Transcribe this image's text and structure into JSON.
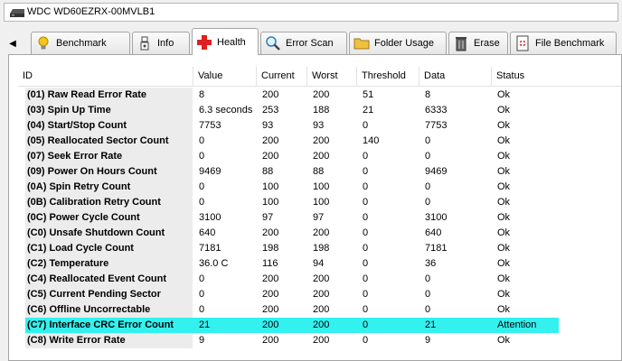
{
  "drive": {
    "label": "WDC WD60EZRX-00MVLB1"
  },
  "tabs": [
    {
      "label": "Benchmark",
      "icon": "light-bulb-icon"
    },
    {
      "label": "Info",
      "icon": "info-icon"
    },
    {
      "label": "Health",
      "icon": "red-cross-icon",
      "active": true
    },
    {
      "label": "Error Scan",
      "icon": "magnifier-icon"
    },
    {
      "label": "Folder Usage",
      "icon": "folder-icon"
    },
    {
      "label": "Erase",
      "icon": "trash-can-icon"
    },
    {
      "label": "File Benchmark",
      "icon": "file-benchmark-icon"
    }
  ],
  "table": {
    "columns": [
      "ID",
      "Value",
      "Current",
      "Worst",
      "Threshold",
      "Data",
      "Status"
    ],
    "rows": [
      [
        "(01) Raw Read Error Rate",
        "8",
        "200",
        "200",
        "51",
        "8",
        "Ok"
      ],
      [
        "(03) Spin Up Time",
        "6.3 seconds",
        "253",
        "188",
        "21",
        "6333",
        "Ok"
      ],
      [
        "(04) Start/Stop Count",
        "7753",
        "93",
        "93",
        "0",
        "7753",
        "Ok"
      ],
      [
        "(05) Reallocated Sector Count",
        "0",
        "200",
        "200",
        "140",
        "0",
        "Ok"
      ],
      [
        "(07) Seek Error Rate",
        "0",
        "200",
        "200",
        "0",
        "0",
        "Ok"
      ],
      [
        "(09) Power On Hours Count",
        "9469",
        "88",
        "88",
        "0",
        "9469",
        "Ok"
      ],
      [
        "(0A) Spin Retry Count",
        "0",
        "100",
        "100",
        "0",
        "0",
        "Ok"
      ],
      [
        "(0B) Calibration Retry Count",
        "0",
        "100",
        "100",
        "0",
        "0",
        "Ok"
      ],
      [
        "(0C) Power Cycle Count",
        "3100",
        "97",
        "97",
        "0",
        "3100",
        "Ok"
      ],
      [
        "(C0) Unsafe Shutdown Count",
        "640",
        "200",
        "200",
        "0",
        "640",
        "Ok"
      ],
      [
        "(C1) Load Cycle Count",
        "7181",
        "198",
        "198",
        "0",
        "7181",
        "Ok"
      ],
      [
        "(C2) Temperature",
        "36.0 C",
        "116",
        "94",
        "0",
        "36",
        "Ok"
      ],
      [
        "(C4) Reallocated Event Count",
        "0",
        "200",
        "200",
        "0",
        "0",
        "Ok"
      ],
      [
        "(C5) Current Pending Sector",
        "0",
        "200",
        "200",
        "0",
        "0",
        "Ok"
      ],
      [
        "(C6) Offline Uncorrectable",
        "0",
        "200",
        "200",
        "0",
        "0",
        "Ok"
      ],
      [
        "(C7) Interface CRC Error Count",
        "21",
        "200",
        "200",
        "0",
        "21",
        "Attention"
      ],
      [
        "(C8) Write Error Rate",
        "9",
        "200",
        "200",
        "0",
        "9",
        "Ok"
      ]
    ],
    "highlight_row": 15,
    "highlight_color": "#33f1ef"
  }
}
